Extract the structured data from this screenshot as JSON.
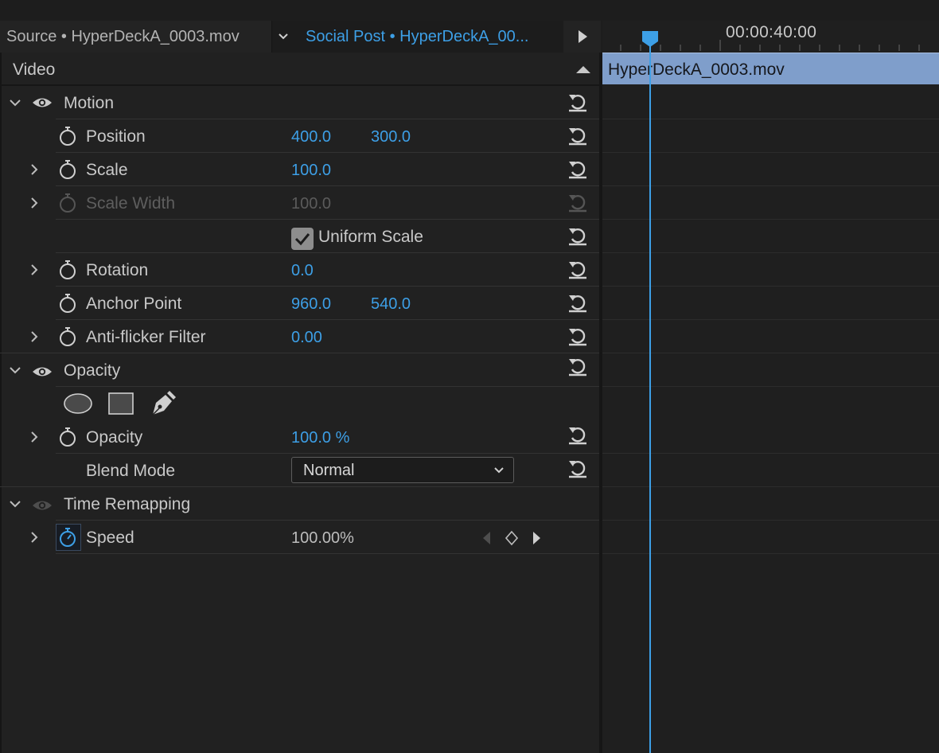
{
  "tabs": {
    "source": "Source • HyperDeckA_0003.mov",
    "active": "Social Post • HyperDeckA_00..."
  },
  "ruler": {
    "timecode": "00:00:40:00"
  },
  "panel": {
    "section": "Video",
    "motion": {
      "label": "Motion",
      "position": {
        "label": "Position",
        "x": "400.0",
        "y": "300.0"
      },
      "scale": {
        "label": "Scale",
        "value": "100.0"
      },
      "scale_width": {
        "label": "Scale Width",
        "value": "100.0"
      },
      "uniform_scale": {
        "label": "Uniform Scale",
        "checked": true
      },
      "rotation": {
        "label": "Rotation",
        "value": "0.0"
      },
      "anchor_point": {
        "label": "Anchor Point",
        "x": "960.0",
        "y": "540.0"
      },
      "anti_flicker": {
        "label": "Anti-flicker Filter",
        "value": "0.00"
      }
    },
    "opacity": {
      "label": "Opacity",
      "opacity_param": {
        "label": "Opacity",
        "value": "100.0 %"
      },
      "blend_mode": {
        "label": "Blend Mode",
        "value": "Normal"
      }
    },
    "time_remapping": {
      "label": "Time Remapping",
      "speed": {
        "label": "Speed",
        "value": "100.00%"
      }
    }
  },
  "timeline": {
    "clip_name": "HyperDeckA_0003.mov"
  },
  "colors": {
    "accent": "#3d9fe6",
    "clip": "#7f9ecb",
    "panel": "#212121"
  }
}
